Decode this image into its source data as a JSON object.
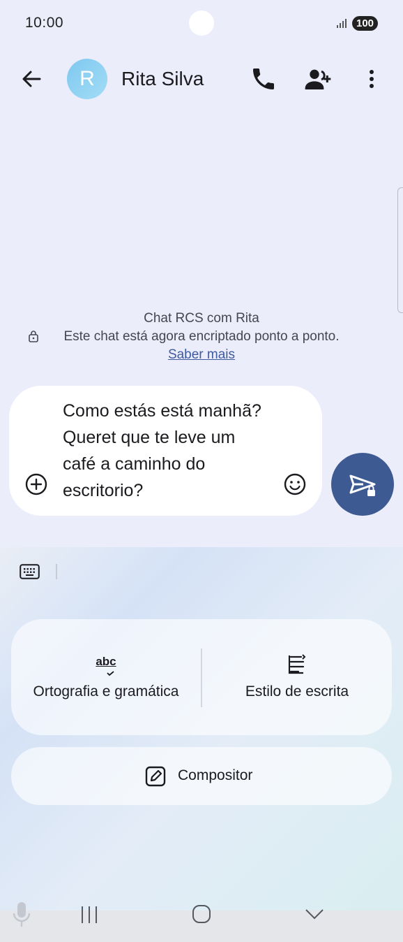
{
  "status_bar": {
    "time": "10:00",
    "battery": "100"
  },
  "header": {
    "avatar_letter": "R",
    "contact_name": "Rita Silva"
  },
  "chat_info": {
    "title": "Chat RCS com Rita",
    "encryption": "Este chat está agora encriptado ponto a ponto.",
    "learn_more": "Saber mais"
  },
  "composer": {
    "message_lines": [
      "Como estás está manhã?",
      "Queret que te leve um",
      "café a caminho do",
      "escritorio?"
    ]
  },
  "assistant": {
    "spelling_label": "Ortografia e gramática",
    "spelling_icon_text": "abc",
    "style_label": "Estilo de escrita",
    "compositor_label": "Compositor"
  },
  "colors": {
    "send_button": "#3e5a92",
    "link": "#3f5aa0",
    "avatar": "#8ed0f2"
  }
}
